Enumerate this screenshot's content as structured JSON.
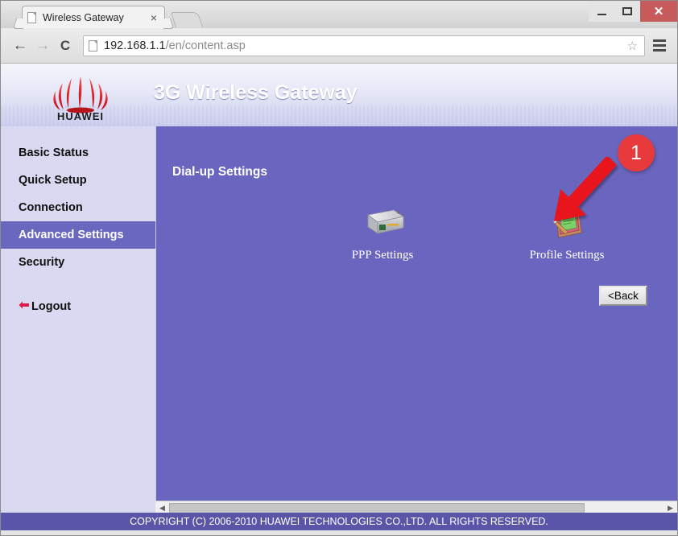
{
  "window": {
    "minimize_label": "—",
    "maximize_label": "",
    "close_label": "✕"
  },
  "browser": {
    "tab_title": "Wireless Gateway",
    "tab_close_label": "×",
    "back_label": "←",
    "forward_label": "→",
    "reload_label": "C",
    "url_host": "192.168.1.1",
    "url_path": "/en/content.asp",
    "star_label": "☆"
  },
  "router": {
    "brand": "HUAWEI",
    "header_title": "3G Wireless Gateway",
    "sidebar": {
      "items": [
        {
          "label": "Basic Status",
          "active": false
        },
        {
          "label": "Quick Setup",
          "active": false
        },
        {
          "label": "Connection",
          "active": false
        },
        {
          "label": "Advanced Settings",
          "active": true
        },
        {
          "label": "Security",
          "active": false
        }
      ],
      "logout_label": "Logout"
    },
    "content": {
      "title": "Dial-up Settings",
      "tiles": [
        {
          "label": "PPP Settings",
          "icon": "modem-device-icon"
        },
        {
          "label": "Profile Settings",
          "icon": "monitor-wrench-icon"
        }
      ],
      "back_button_label": "<Back"
    },
    "annotation": {
      "badge_number": "1",
      "target": "Profile Settings"
    },
    "footer": "COPYRIGHT (C) 2006-2010 HUAWEI TECHNOLOGIES CO.,LTD. ALL RIGHTS RESERVED.",
    "scrollbar": {
      "left_arrow": "◀",
      "right_arrow": "▶"
    }
  },
  "colors": {
    "content_bg": "#6a66bf",
    "sidebar_bg": "#d9d9f1",
    "active_nav": "#6a67bf",
    "footer_bg": "#5a55a8",
    "badge_red": "#e8393c",
    "brand_red": "#d8232a"
  }
}
